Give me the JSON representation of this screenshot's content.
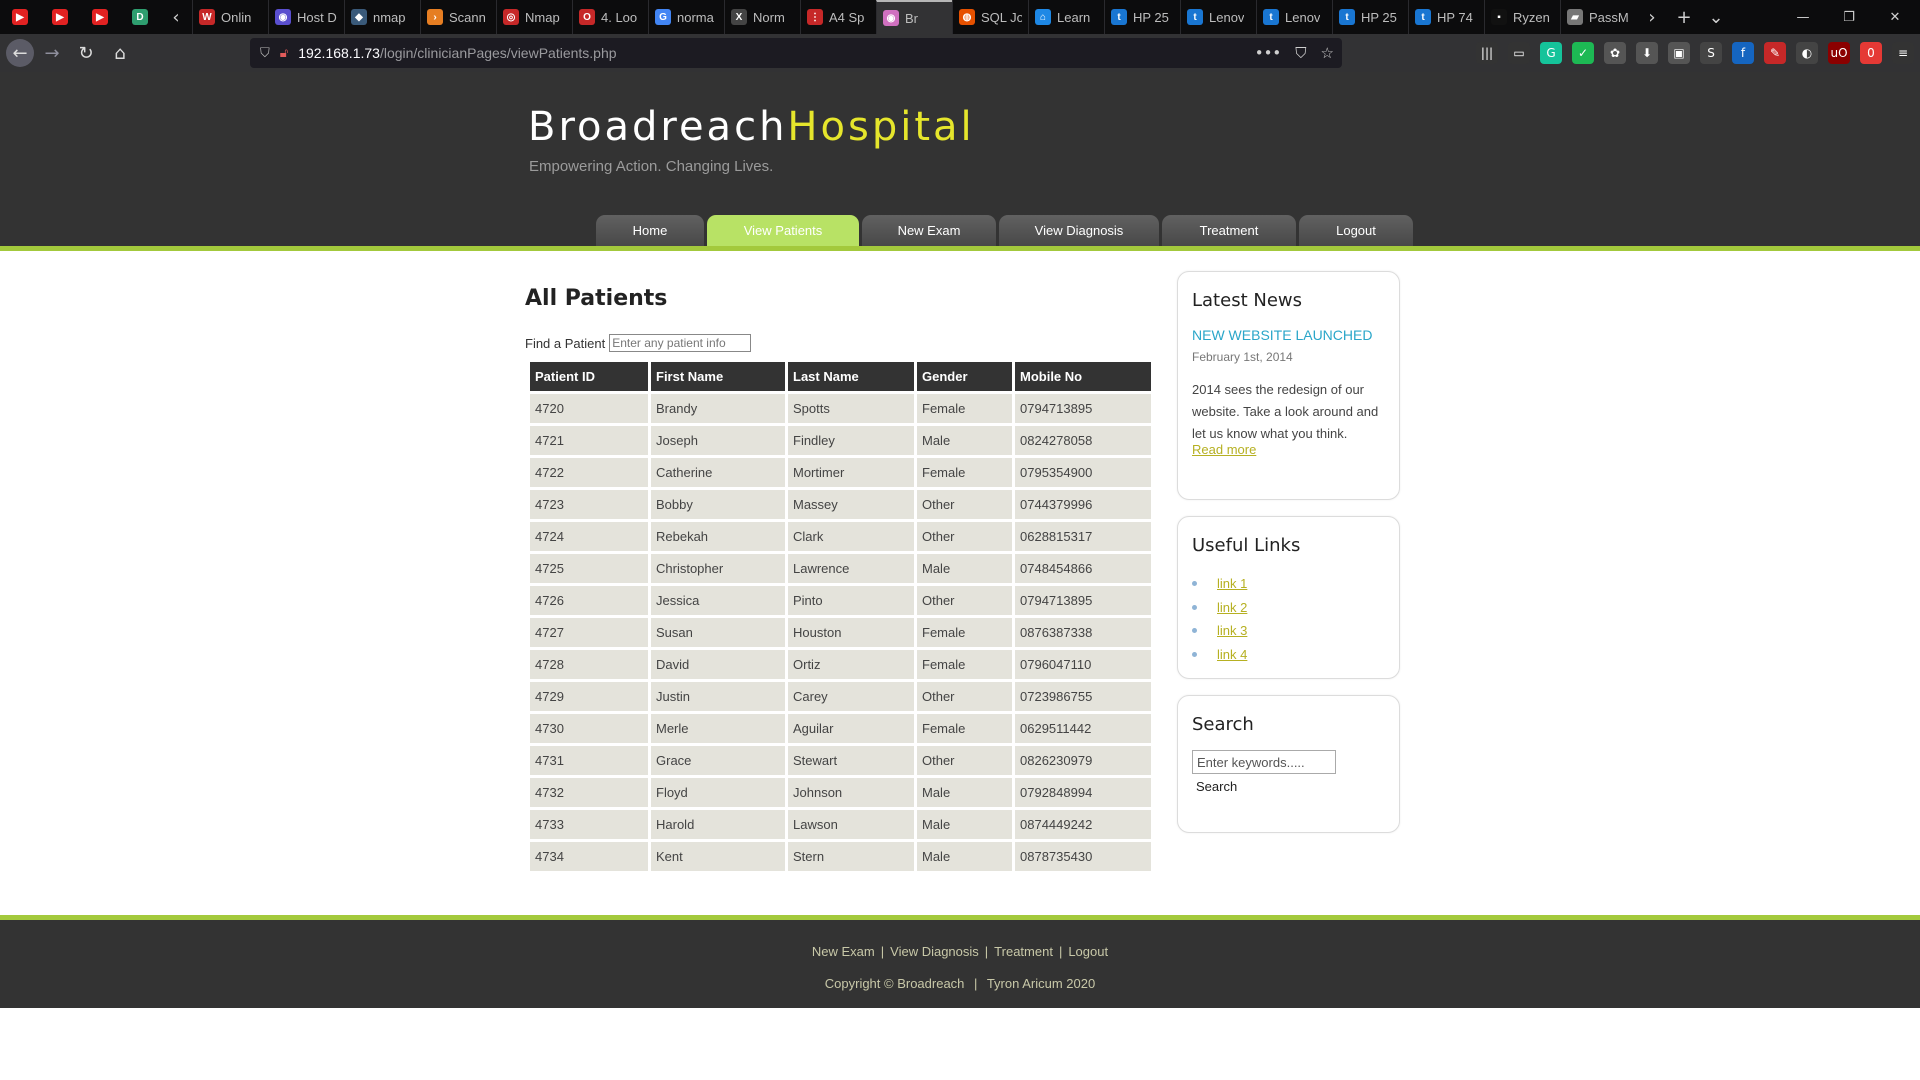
{
  "browser": {
    "tabs": [
      {
        "title": "",
        "color": "#e22222",
        "glyph": "▶",
        "pinned": true
      },
      {
        "title": "",
        "color": "#e22222",
        "glyph": "▶",
        "pinned": true
      },
      {
        "title": "",
        "color": "#e22222",
        "glyph": "▶",
        "pinned": true
      },
      {
        "title": "",
        "color": "#2e9e6f",
        "glyph": "D",
        "pinned": true
      },
      {
        "title": "Onlin",
        "color": "#c62828",
        "glyph": "W",
        "pinned": false
      },
      {
        "title": "Host D",
        "color": "#5a4fcf",
        "glyph": "◉",
        "pinned": false
      },
      {
        "title": "nmap",
        "color": "#3a5a7a",
        "glyph": "◆",
        "pinned": false
      },
      {
        "title": "Scann",
        "color": "#e67e22",
        "glyph": "›",
        "pinned": false
      },
      {
        "title": "Nmap",
        "color": "#c62828",
        "glyph": "◎",
        "pinned": false
      },
      {
        "title": "4. Loo",
        "color": "#c62828",
        "glyph": "O",
        "pinned": false
      },
      {
        "title": "norma",
        "color": "#4285f4",
        "glyph": "G",
        "pinned": false
      },
      {
        "title": "Norm",
        "color": "#444444",
        "glyph": "X",
        "pinned": false
      },
      {
        "title": "A4 Sp",
        "color": "#c62828",
        "glyph": "⋮",
        "pinned": false
      },
      {
        "title": "Br",
        "color": "#d070c0",
        "glyph": "◉",
        "pinned": false,
        "active": true
      },
      {
        "title": "SQL Jo",
        "color": "#e65100",
        "glyph": "◍",
        "pinned": false
      },
      {
        "title": "Learn",
        "color": "#1e88e5",
        "glyph": "⌂",
        "pinned": false
      },
      {
        "title": "HP 25",
        "color": "#1976d2",
        "glyph": "t",
        "pinned": false
      },
      {
        "title": "Lenov",
        "color": "#1976d2",
        "glyph": "t",
        "pinned": false
      },
      {
        "title": "Lenov",
        "color": "#1976d2",
        "glyph": "t",
        "pinned": false
      },
      {
        "title": "HP 25",
        "color": "#1976d2",
        "glyph": "t",
        "pinned": false
      },
      {
        "title": "HP 74",
        "color": "#1976d2",
        "glyph": "t",
        "pinned": false
      },
      {
        "title": "Ryzen",
        "color": "#111111",
        "glyph": "▪",
        "pinned": false
      },
      {
        "title": "PassM",
        "color": "#777777",
        "glyph": "▰",
        "pinned": false
      }
    ],
    "url_host": "192.168.1.73",
    "url_path": "/login/clinicianPages/viewPatients.php",
    "extensions": [
      {
        "color": "#333333",
        "glyph": "|||"
      },
      {
        "color": "#333333",
        "glyph": "▭"
      },
      {
        "color": "#15c39a",
        "glyph": "G"
      },
      {
        "color": "#1db954",
        "glyph": "✓"
      },
      {
        "color": "#555555",
        "glyph": "✿"
      },
      {
        "color": "#555555",
        "glyph": "⬇"
      },
      {
        "color": "#555555",
        "glyph": "▣"
      },
      {
        "color": "#444444",
        "glyph": "S"
      },
      {
        "color": "#1565c0",
        "glyph": "f"
      },
      {
        "color": "#c62828",
        "glyph": "✎"
      },
      {
        "color": "#444444",
        "glyph": "◐"
      },
      {
        "color": "#8b0000",
        "glyph": "uO"
      },
      {
        "color": "#e53935",
        "glyph": "0"
      },
      {
        "color": "#333333",
        "glyph": "≡"
      }
    ]
  },
  "site": {
    "logo_main": "Broadreach",
    "logo_highlight": "Hospital",
    "slogan": "Empowering Action. Changing Lives.",
    "menu": [
      {
        "label": "Home",
        "current": false
      },
      {
        "label": "View Patients",
        "current": true
      },
      {
        "label": "New Exam",
        "current": false
      },
      {
        "label": "View Diagnosis",
        "current": false
      },
      {
        "label": "Treatment",
        "current": false
      },
      {
        "label": "Logout",
        "current": false
      }
    ]
  },
  "main": {
    "title": "All Patients",
    "find_label": "Find a Patient",
    "find_placeholder": "Enter any patient info",
    "columns": [
      "Patient ID",
      "First Name",
      "Last Name",
      "Gender",
      "Mobile No"
    ],
    "rows": [
      [
        "4720",
        "Brandy",
        "Spotts",
        "Female",
        "0794713895"
      ],
      [
        "4721",
        "Joseph",
        "Findley",
        "Male",
        "0824278058"
      ],
      [
        "4722",
        "Catherine",
        "Mortimer",
        "Female",
        "0795354900"
      ],
      [
        "4723",
        "Bobby",
        "Massey",
        "Other",
        "0744379996"
      ],
      [
        "4724",
        "Rebekah",
        "Clark",
        "Other",
        "0628815317"
      ],
      [
        "4725",
        "Christopher",
        "Lawrence",
        "Male",
        "0748454866"
      ],
      [
        "4726",
        "Jessica",
        "Pinto",
        "Other",
        "0794713895"
      ],
      [
        "4727",
        "Susan",
        "Houston",
        "Female",
        "0876387338"
      ],
      [
        "4728",
        "David",
        "Ortiz",
        "Female",
        "0796047110"
      ],
      [
        "4729",
        "Justin",
        "Carey",
        "Other",
        "0723986755"
      ],
      [
        "4730",
        "Merle",
        "Aguilar",
        "Female",
        "0629511442"
      ],
      [
        "4731",
        "Grace",
        "Stewart",
        "Other",
        "0826230979"
      ],
      [
        "4732",
        "Floyd",
        "Johnson",
        "Male",
        "0792848994"
      ],
      [
        "4733",
        "Harold",
        "Lawson",
        "Male",
        "0874449242"
      ],
      [
        "4734",
        "Kent",
        "Stern",
        "Male",
        "0878735430"
      ]
    ]
  },
  "sidebar": {
    "news": {
      "heading": "Latest News",
      "title": "NEW WEBSITE LAUNCHED",
      "date": "February 1st, 2014",
      "body": "2014 sees the redesign of our website. Take a look around and let us know what you think.",
      "more": "Read more"
    },
    "links": {
      "heading": "Useful Links",
      "items": [
        "link 1",
        "link 2",
        "link 3",
        "link 4"
      ]
    },
    "search": {
      "heading": "Search",
      "placeholder": "Enter keywords.....",
      "button": "Search"
    }
  },
  "footer": {
    "links": [
      "New Exam",
      "View Diagnosis",
      "Treatment",
      "Logout"
    ],
    "separator": "|",
    "copyright": "Copyright © Broadreach",
    "author": "Tyron Aricum 2020"
  }
}
